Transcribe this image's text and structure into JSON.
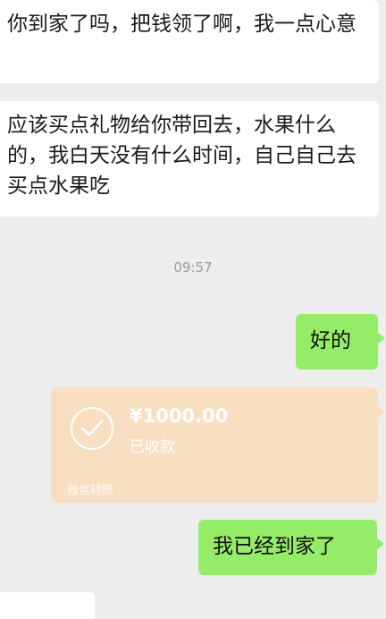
{
  "messages": {
    "incoming_1": "你到家了吗，把钱领了啊，我一点心意",
    "incoming_2": "应该买点礼物给你带回去，水果什么的，我白天没有什么时间，自己自己去买点水果吃",
    "timestamp": "09:57",
    "outgoing_1": "好的",
    "outgoing_2": "我已经到家了"
  },
  "transfer": {
    "amount": "¥1000.00",
    "status": "已收款",
    "footer": "微信转账",
    "icon": "check-circle-icon"
  },
  "colors": {
    "background": "#ededed",
    "incoming_bubble": "#ffffff",
    "outgoing_bubble": "#95ec69",
    "transfer_card": "#f9dfc1"
  }
}
